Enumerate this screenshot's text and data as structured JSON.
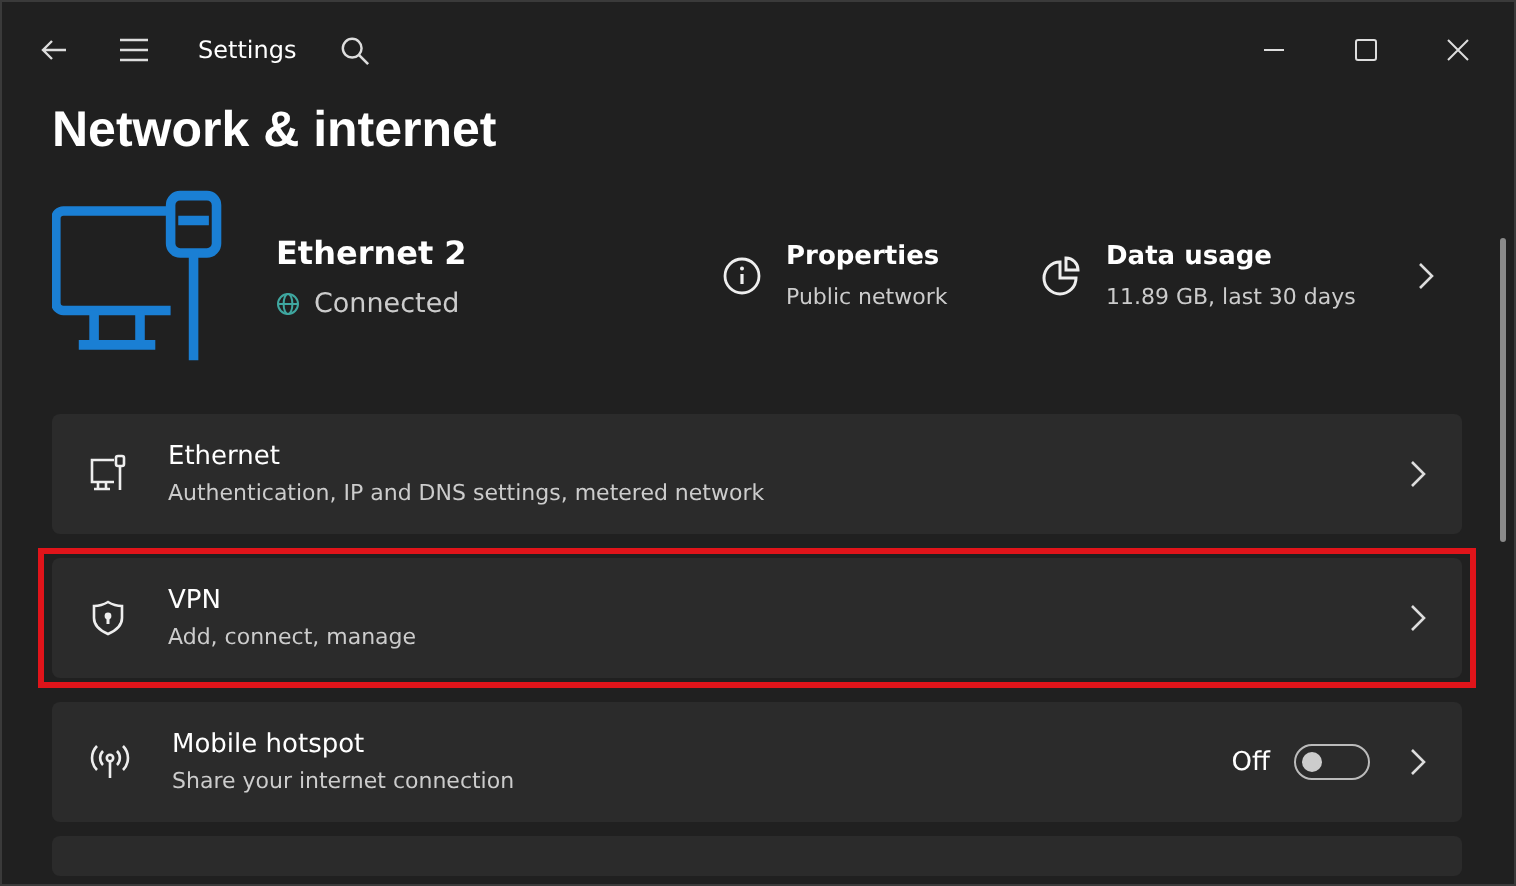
{
  "window": {
    "title": "Settings"
  },
  "page_title": "Network & internet",
  "connection": {
    "name": "Ethernet 2",
    "status": "Connected"
  },
  "properties": {
    "title": "Properties",
    "subtitle": "Public network"
  },
  "data_usage": {
    "title": "Data usage",
    "subtitle": "11.89 GB, last 30 days"
  },
  "items": [
    {
      "kind": "link",
      "title": "Ethernet",
      "subtitle": "Authentication, IP and DNS settings, metered network",
      "highlighted": false
    },
    {
      "kind": "link",
      "title": "VPN",
      "subtitle": "Add, connect, manage",
      "highlighted": true
    },
    {
      "kind": "toggle",
      "title": "Mobile hotspot",
      "subtitle": "Share your internet connection",
      "highlighted": false,
      "on": false,
      "state_label": "Off"
    }
  ]
}
